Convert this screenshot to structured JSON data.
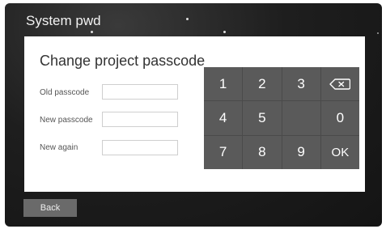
{
  "header": {
    "title": "System pwd"
  },
  "form": {
    "heading": "Change project passcode",
    "fields": [
      {
        "label": "Old passcode",
        "value": "",
        "placeholder": ""
      },
      {
        "label": "New passcode",
        "value": "",
        "placeholder": ""
      },
      {
        "label": "New again",
        "value": "",
        "placeholder": ""
      }
    ]
  },
  "keypad": {
    "keys": [
      "1",
      "2",
      "3",
      "backspace",
      "4",
      "5",
      "0",
      "7",
      "8",
      "9",
      "OK"
    ]
  },
  "footer": {
    "back_label": "Back"
  },
  "colors": {
    "background": "#1e1e1e",
    "panel": "#ffffff",
    "keypad_key": "#5a5a5a",
    "back_button": "#6a6a6a"
  }
}
